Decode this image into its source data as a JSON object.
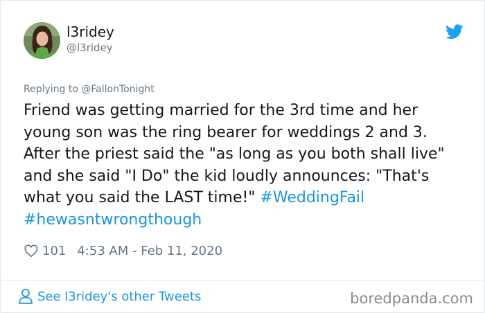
{
  "user": {
    "display_name": "l3ridey",
    "handle": "@l3ridey"
  },
  "tweet": {
    "replying_to": "Replying to @FallonTonight",
    "text": "Friend was getting married for the 3rd time and her young son was the ring bearer for weddings 2 and 3. After the priest said the \"as long as you both shall live\" and she said \"I Do\" the kid loudly announces: \"That's what you said the LAST time!\" ",
    "hashtag1": "#WeddingFail",
    "hashtag2": "#hewasntwrongthough",
    "likes": "101",
    "timestamp": "4:53 AM - Feb 11, 2020"
  },
  "footer": {
    "see_other": "See l3ridey's other Tweets",
    "watermark": "boredpanda.com"
  },
  "colors": {
    "accent": "#1b95e0",
    "muted": "#657786",
    "text": "#14171a"
  },
  "icons": [
    "twitter-bird-icon",
    "heart-icon",
    "person-icon"
  ]
}
